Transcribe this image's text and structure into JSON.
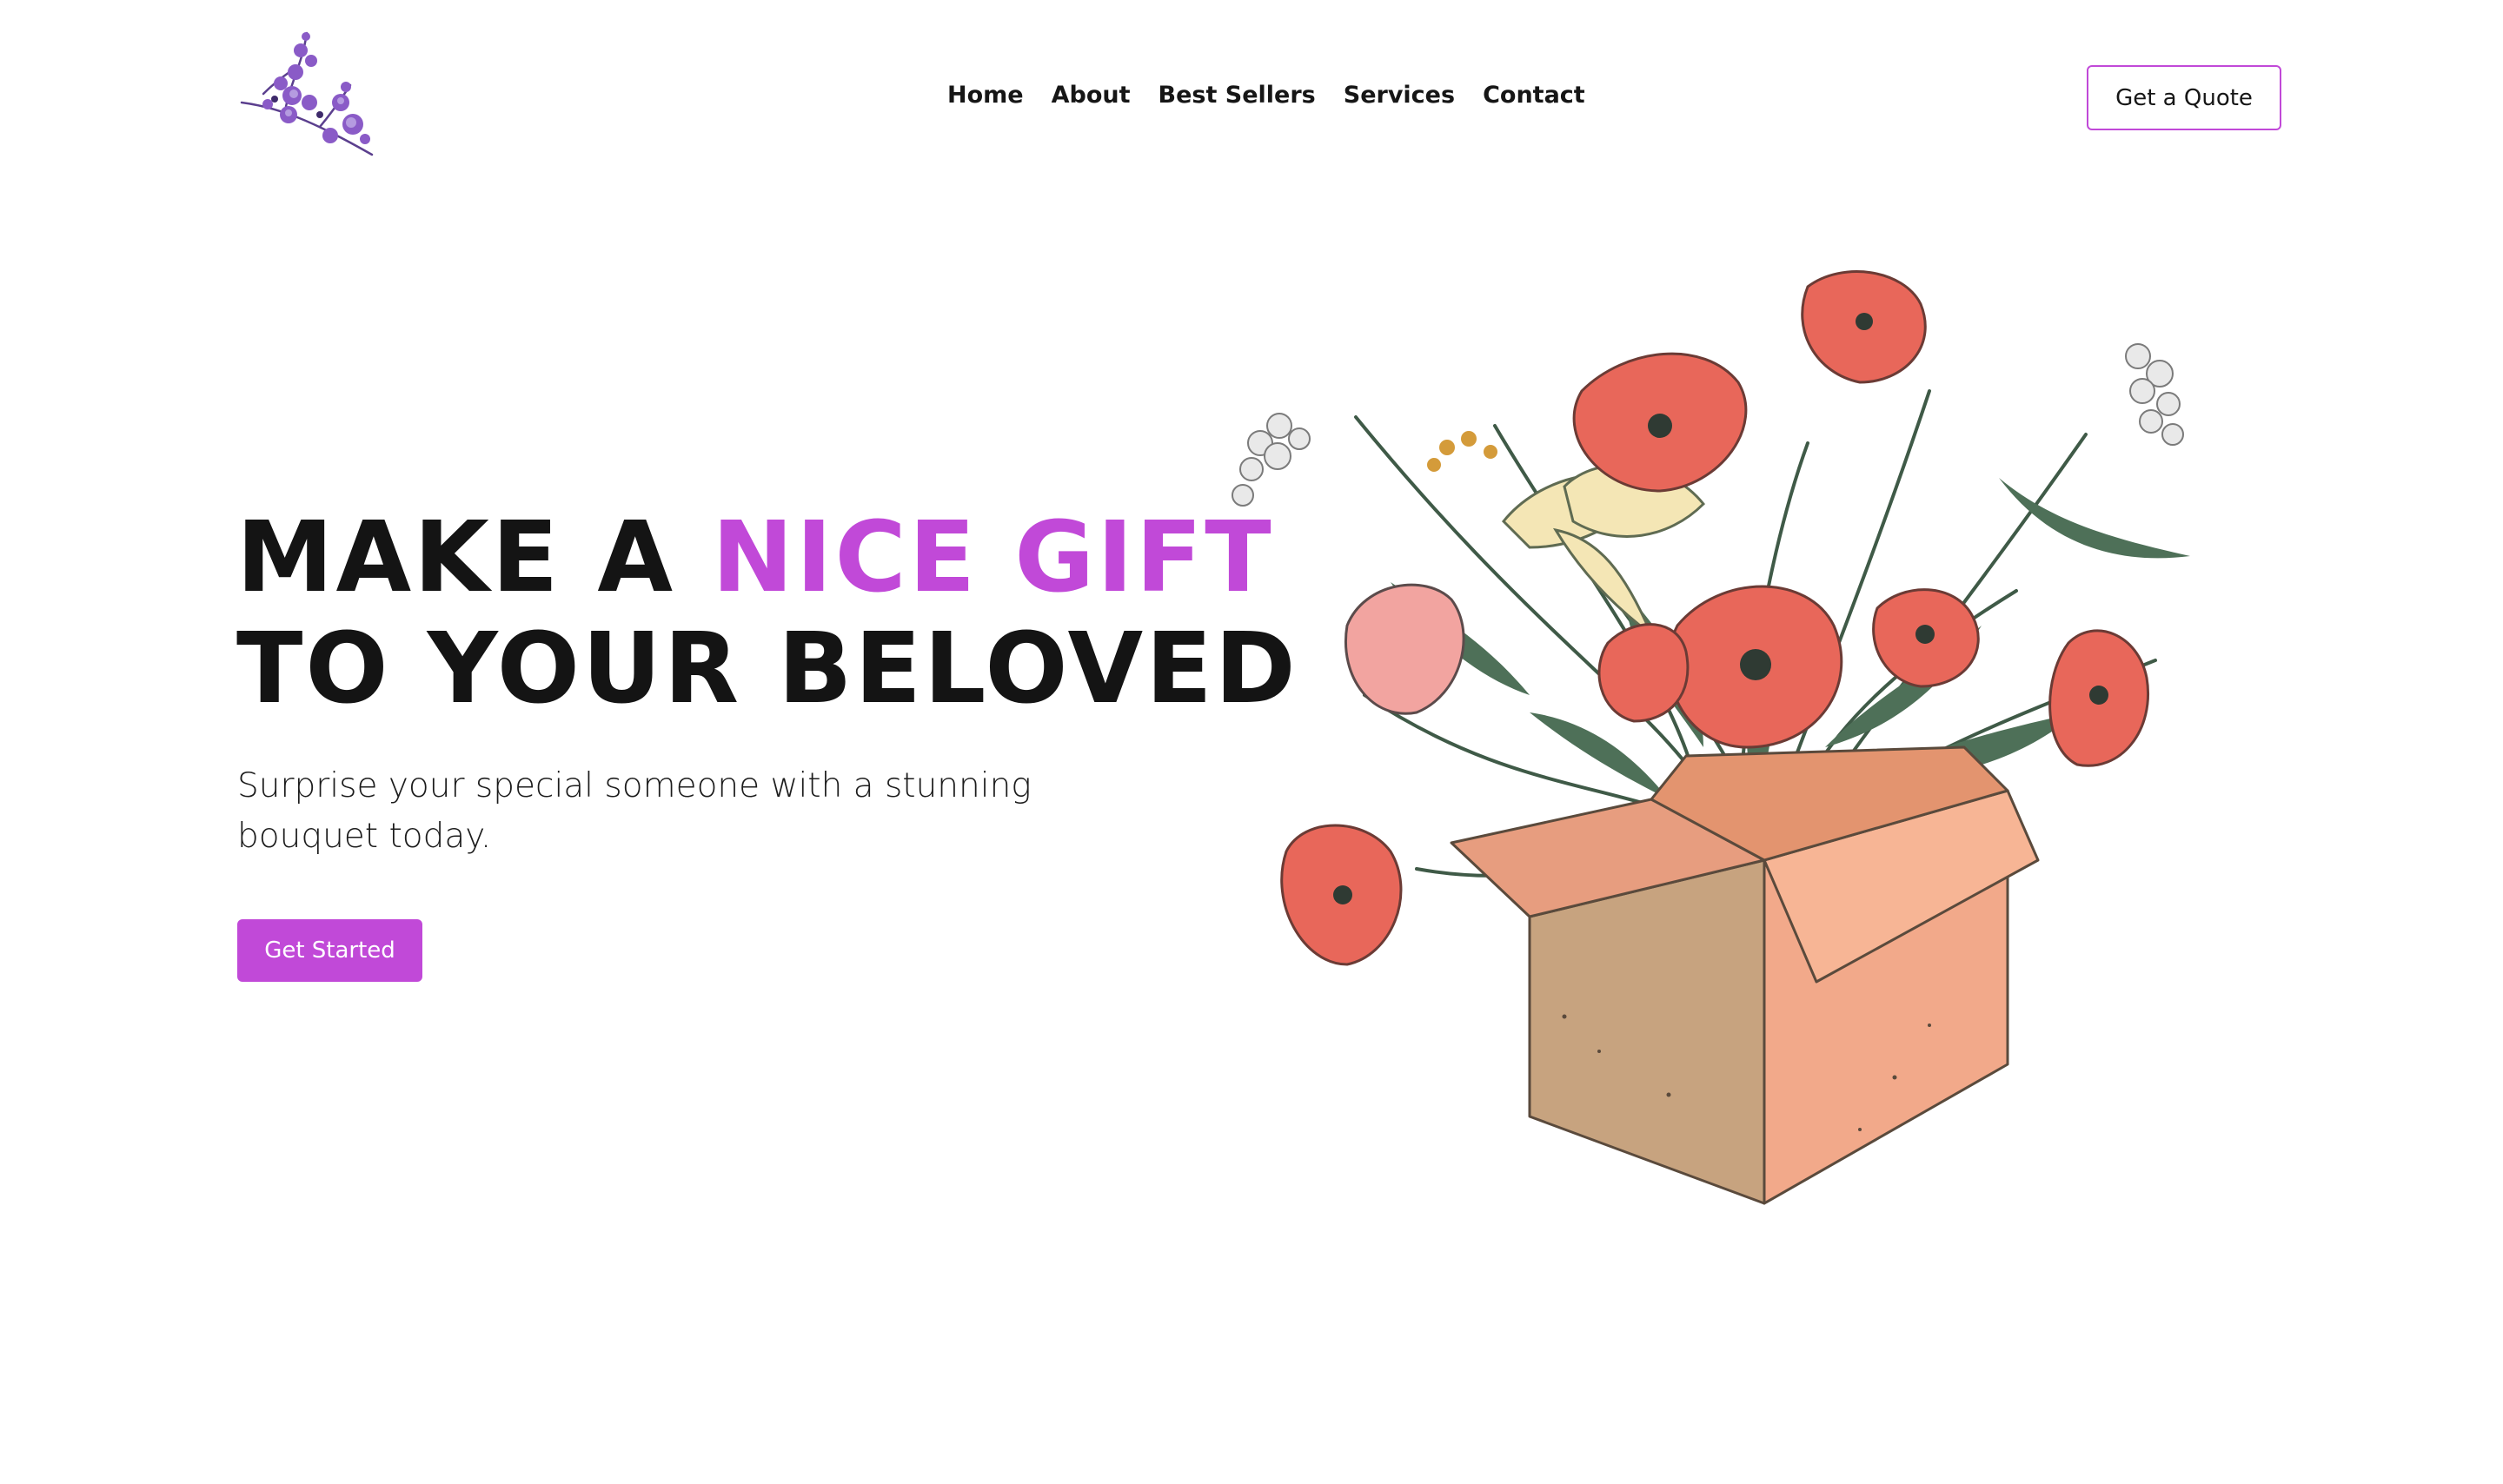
{
  "header": {
    "logo_icon": "lavender-sprig-icon",
    "nav": [
      {
        "label": "Home"
      },
      {
        "label": "About"
      },
      {
        "label": "Best Sellers"
      },
      {
        "label": "Services"
      },
      {
        "label": "Contact"
      }
    ],
    "quote_button": "Get a Quote"
  },
  "hero": {
    "headline_line1_prefix": "MAKE A ",
    "headline_line1_accent": "NICE GIFT",
    "headline_line2": "TO YOUR BELOVED",
    "subtitle": "Surprise your special someone with a stunning bouquet today.",
    "cta_button": "Get Started",
    "illustration_icon": "flower-box-illustration"
  },
  "colors": {
    "accent": "#c149d8",
    "text": "#141414",
    "background": "#ffffff",
    "poppy": "#e8675a",
    "box": "#f2a98a"
  }
}
